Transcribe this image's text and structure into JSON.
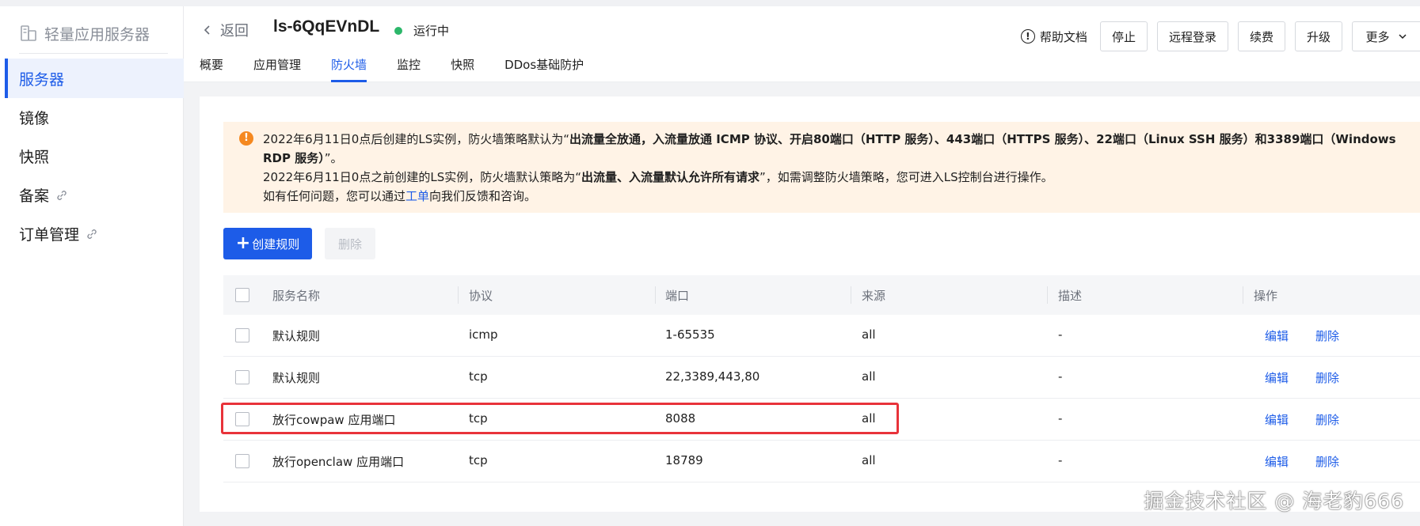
{
  "sidebar": {
    "title": "轻量应用服务器",
    "items": [
      {
        "label": "服务器",
        "active": true
      },
      {
        "label": "镜像"
      },
      {
        "label": "快照"
      },
      {
        "label": "备案"
      },
      {
        "label": "订单管理"
      }
    ]
  },
  "header": {
    "back_label": "返回",
    "instance_name": "ls-6QqEVnDL",
    "status": "运行中",
    "help_label": "帮助文档",
    "buttons": {
      "stop": "停止",
      "remote_login": "远程登录",
      "renew": "续费",
      "upgrade": "升级",
      "more": "更多"
    },
    "tabs": [
      "概要",
      "应用管理",
      "防火墙",
      "监控",
      "快照",
      "DDos基础防护"
    ],
    "active_tab": "防火墙"
  },
  "notice": {
    "line1_a": "2022年6月11日0点后创建的LS实例，防火墙策略默认为“",
    "line1_bold": "出流量全放通，入流量放通 ICMP 协议、开启80端口（HTTP 服务）、443端口（HTTPS 服务）、22端口（Linux SSH 服务）和3389端口（Windows RDP 服务）",
    "line1_b": "”。",
    "line2_a": "2022年6月11日0点之前创建的LS实例，防火墙默认策略为“",
    "line2_bold": "出流量、入流量默认允许所有请求",
    "line2_b": "”，如需调整防火墙策略，您可进入LS控制台进行操作。",
    "line3_a": "如有任何问题，您可以通过",
    "line3_link": "工单",
    "line3_b": "向我们反馈和咨询。"
  },
  "toolbar": {
    "create_label": "创建规则",
    "delete_label": "删除"
  },
  "table": {
    "headers": [
      "服务名称",
      "协议",
      "端口",
      "来源",
      "描述",
      "操作"
    ],
    "rows": [
      {
        "name": "默认规则",
        "protocol": "icmp",
        "port": "1-65535",
        "source": "all",
        "desc": "-"
      },
      {
        "name": "默认规则",
        "protocol": "tcp",
        "port": "22,3389,443,80",
        "source": "all",
        "desc": "-"
      },
      {
        "name": "放行cowpaw 应用端口",
        "protocol": "tcp",
        "port": "8088",
        "source": "all",
        "desc": "-"
      },
      {
        "name": "放行openclaw 应用端口",
        "protocol": "tcp",
        "port": "18789",
        "source": "all",
        "desc": "-"
      }
    ],
    "edit_label": "编辑",
    "delete_label": "删除"
  },
  "watermark": "掘金技术社区 @ 海老豹666",
  "colors": {
    "accent": "#1d5ce8",
    "notice_bg": "#fff3e6",
    "warning": "#f5881f",
    "running": "#2cb76a",
    "highlight": "#e8333a"
  }
}
